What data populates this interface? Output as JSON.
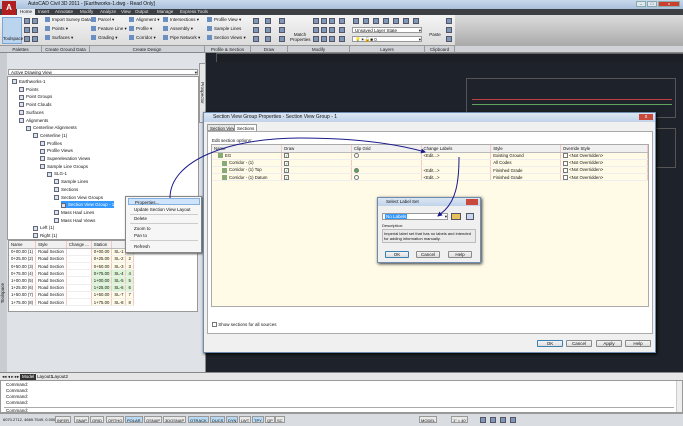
{
  "app": {
    "title": "AutoCAD Civil 3D 2011 - [Earthworks-1.dwg - Read Only]",
    "minimize": "–",
    "maximize": "□",
    "close": "x"
  },
  "ribbon": {
    "tabs": [
      "Home",
      "Insert",
      "Annotate",
      "Modify",
      "Analyze",
      "View",
      "Output",
      "Manage",
      "Express Tools"
    ],
    "toolspace": "Toolspace",
    "ground": [
      "Import Survey Data",
      "Points",
      "Surfaces"
    ],
    "design1": [
      "Parcel",
      "Feature Line",
      "Grading"
    ],
    "design2": [
      "Alignment",
      "Profile",
      "Corridor"
    ],
    "design3": [
      "Intersections",
      "Assembly",
      "Pipe Network"
    ],
    "sections": [
      "Profile View",
      "Sample Lines",
      "Section Views"
    ],
    "match": "Match Properties",
    "layer_state": "Unsaved Layer State",
    "layer_current": "0",
    "paste": "Paste",
    "panels": [
      "Palettes",
      "Create Ground Data",
      "Create Design",
      "Profile & Section Views",
      "Draw",
      "Modify",
      "Layers",
      "Clipboard"
    ]
  },
  "toolspace": {
    "vertical_label": "Toolspace",
    "prospector_tab": "Prospector",
    "view_select": "Active Drawing View",
    "tree": [
      {
        "label": "Earthworks-1",
        "level": 0
      },
      {
        "label": "Points",
        "level": 1
      },
      {
        "label": "Point Groups",
        "level": 1
      },
      {
        "label": "Point Clouds",
        "level": 1
      },
      {
        "label": "Surfaces",
        "level": 1
      },
      {
        "label": "Alignments",
        "level": 1
      },
      {
        "label": "Centerline Alignments",
        "level": 2
      },
      {
        "label": "Centerline (1)",
        "level": 3
      },
      {
        "label": "Profiles",
        "level": 4
      },
      {
        "label": "Profile Views",
        "level": 4
      },
      {
        "label": "Superelevation Views",
        "level": 4
      },
      {
        "label": "Sample Line Groups",
        "level": 4
      },
      {
        "label": "SLG-1",
        "level": 5
      },
      {
        "label": "Sample Lines",
        "level": 6
      },
      {
        "label": "Sections",
        "level": 6
      },
      {
        "label": "Section View Groups",
        "level": 6
      },
      {
        "label": "Section View Group - 1",
        "level": 7,
        "selected": true
      },
      {
        "label": "Mass Haul Lines",
        "level": 6
      },
      {
        "label": "Mass Haul Views",
        "level": 6
      },
      {
        "label": "Left (1)",
        "level": 3
      },
      {
        "label": "Right (1)",
        "level": 3
      }
    ],
    "grid": {
      "columns": [
        "Name",
        "Style",
        "Change ...",
        "Station",
        "",
        ""
      ],
      "rows": [
        [
          "0+00.00 (1)",
          "Road Section",
          "",
          "0+00.00",
          "SL-1",
          "1"
        ],
        [
          "0+25.00 (2)",
          "Road Section",
          "",
          "0+25.00",
          "SL-2",
          "2"
        ],
        [
          "0+50.00 (3)",
          "Road Section",
          "",
          "0+50.00",
          "SL-3",
          "3"
        ],
        [
          "0+75.00 (4)",
          "Road Section",
          "",
          "0+75.00",
          "SL-4",
          "4"
        ],
        [
          "1+00.00 (5)",
          "Road Section",
          "",
          "1+00.00",
          "SL-5",
          "5"
        ],
        [
          "1+25.00 (6)",
          "Road Section",
          "",
          "1+25.00",
          "SL-6",
          "6"
        ],
        [
          "1+50.00 (7)",
          "Road Section",
          "",
          "1+50.00",
          "SL-7",
          "7"
        ],
        [
          "1+75.00 (8)",
          "Road Section",
          "",
          "1+75.00",
          "SL-8",
          "8"
        ]
      ]
    }
  },
  "context_menu": {
    "items": [
      "Properties...",
      "Update Section View Layout",
      "Delete",
      "Zoom to",
      "Pan to",
      "Refresh"
    ]
  },
  "dialog": {
    "title": "Section View Group Properties - Section View Group - 1",
    "tabs": [
      "Section Views",
      "Sections"
    ],
    "section_label": "Edit section options:",
    "columns": [
      "Name",
      "Draw",
      "Clip Grid",
      "Change Labels",
      "Style",
      "Override Style"
    ],
    "rows": [
      {
        "name": "EG",
        "draw": true,
        "clip": "radio-on",
        "labels": "<Edit...>",
        "style": "Existing Ground",
        "override": "<Not Overridden>"
      },
      {
        "name": "Corridor - (1)",
        "draw": true,
        "clip": "",
        "labels": "",
        "style": "All Codes",
        "override": "<Not Overridden>"
      },
      {
        "name": "Corridor - (1) Top",
        "draw": true,
        "clip": "radio-on",
        "labels": "<Edit...>",
        "style": "Finished Grade",
        "override": "<Not Overridden>"
      },
      {
        "name": "Corridor - (1) Datum",
        "draw": true,
        "clip": "radio-off",
        "labels": "<Edit...>",
        "style": "Finished Grade",
        "override": "<Not Overridden>"
      }
    ],
    "show_all": "Show sections for all sources",
    "buttons": [
      "OK",
      "Cancel",
      "Apply",
      "Help"
    ]
  },
  "label_dialog": {
    "title": "Select Label Set",
    "value": "No Labels",
    "desc_label": "Description:",
    "description": "Imperial label set that has no labels and intended for adding information manually.",
    "buttons": [
      "OK",
      "Cancel",
      "Help"
    ]
  },
  "layout_tabs": [
    "Model",
    "Layout1",
    "Layout2"
  ],
  "command": {
    "history": [
      "Command:",
      "Command:",
      "Command:",
      "Command:"
    ],
    "prompt": "Command:"
  },
  "status": {
    "coords": "6070.2712, 4669.7549, 0.0000",
    "toggles": [
      {
        "l": "INFER",
        "on": false
      },
      {
        "l": "SNAP",
        "on": false
      },
      {
        "l": "GRID",
        "on": false
      },
      {
        "l": "ORTHO",
        "on": false
      },
      {
        "l": "POLAR",
        "on": true
      },
      {
        "l": "OSNAP",
        "on": false
      },
      {
        "l": "3DOSNAP",
        "on": false
      },
      {
        "l": "OTRACK",
        "on": true
      },
      {
        "l": "DUCS",
        "on": true
      },
      {
        "l": "DYN",
        "on": true
      },
      {
        "l": "LWT",
        "on": false
      },
      {
        "l": "TPY",
        "on": true
      },
      {
        "l": "QP",
        "on": false
      },
      {
        "l": "SC",
        "on": false
      }
    ],
    "model": "MODEL",
    "scale": "1\" = 40'"
  }
}
